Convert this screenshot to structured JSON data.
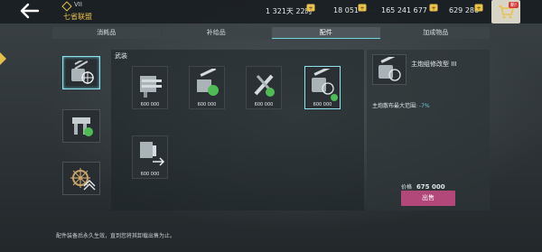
{
  "header": {
    "rank": "VII",
    "fleet_name": "七省联盟",
    "time_left": "1 321天 22时",
    "currency_1": "18 051",
    "currency_2": "165 241 677",
    "currency_3": "629 286",
    "cart_badge": "新!"
  },
  "tabs": [
    {
      "label": "消耗品",
      "active": false
    },
    {
      "label": "补给品",
      "active": false
    },
    {
      "label": "配件",
      "active": true
    },
    {
      "label": "加成物品",
      "active": false
    }
  ],
  "categories": [
    "weapon-turret-icon",
    "engine-icon",
    "helm-wheel-icon"
  ],
  "section": {
    "title": "武装"
  },
  "items": [
    {
      "icon": "cannon-mod-icon",
      "price": "600 000"
    },
    {
      "icon": "turret-rotation-icon",
      "price": "600 000"
    },
    {
      "icon": "tools-icon",
      "price": "600 000"
    },
    {
      "icon": "turret-range-icon",
      "price": "600 000"
    },
    {
      "icon": "reload-icon",
      "price": "600 000"
    }
  ],
  "detail": {
    "name": "主炮组修改型 III",
    "stat_label": "主炮散布最大范围:",
    "stat_value": "-7%",
    "price_label": "价格",
    "price_value": "675 000",
    "sell_label": "出售"
  },
  "footer": {
    "note": "配件装备后永久生效，直到您将其卸载出售为止。"
  },
  "colors": {
    "accent": "#6fd3e0",
    "sell": "#b2477a",
    "gold": "#e9c14b"
  }
}
